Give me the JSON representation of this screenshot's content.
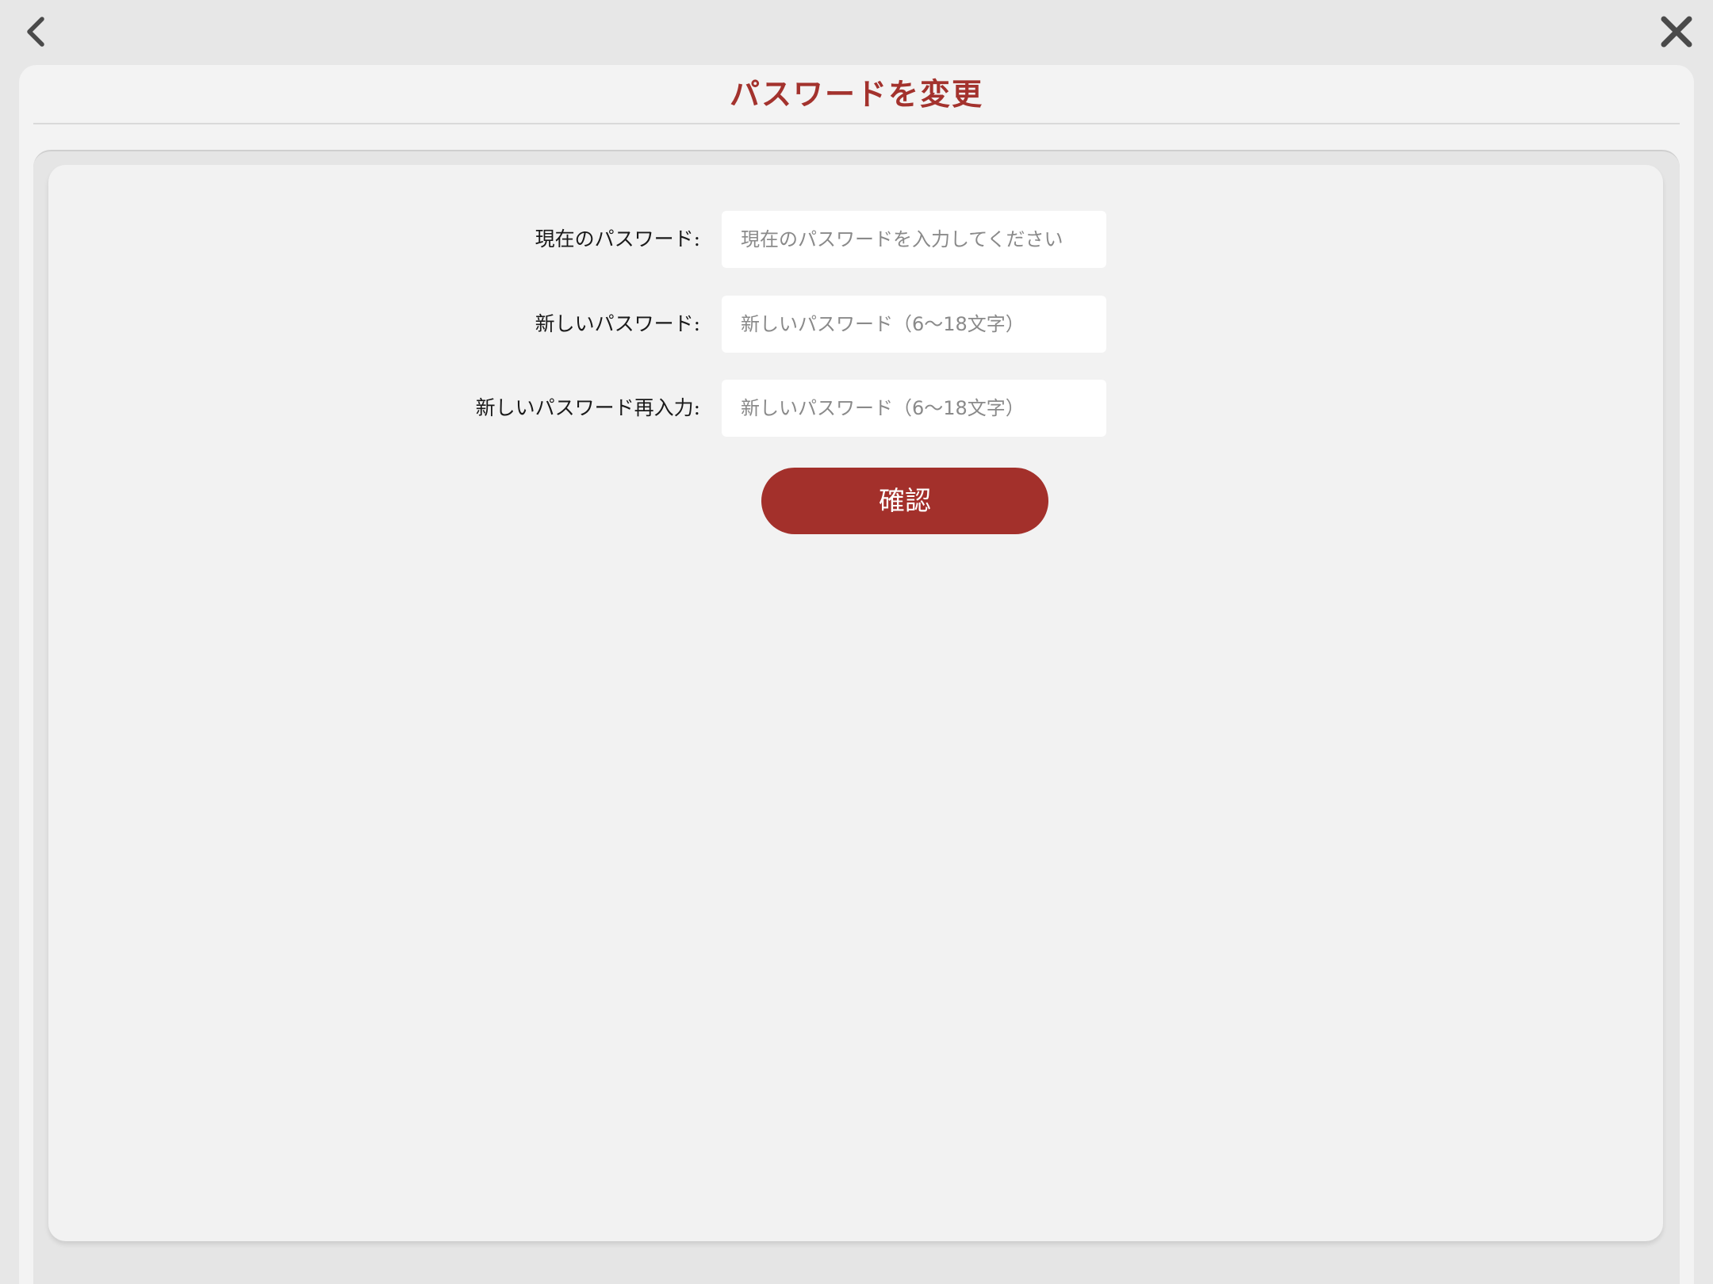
{
  "nav": {
    "back_icon": "chevron-left-icon",
    "close_icon": "close-x-icon"
  },
  "header": {
    "title": "パスワードを変更"
  },
  "form": {
    "current_password": {
      "label": "現在のパスワード:",
      "placeholder": "現在のパスワードを入力してください",
      "value": ""
    },
    "new_password": {
      "label": "新しいパスワード:",
      "placeholder": "新しいパスワード（6〜18文字）",
      "value": ""
    },
    "confirm_password": {
      "label": "新しいパスワード再入力:",
      "placeholder": "新しいパスワード（6〜18文字）",
      "value": ""
    },
    "submit_label": "確認"
  },
  "colors": {
    "accent": "#a3302b",
    "background": "#e7e7e7",
    "card": "#f2f2f2",
    "input_bg": "#ffffff"
  }
}
